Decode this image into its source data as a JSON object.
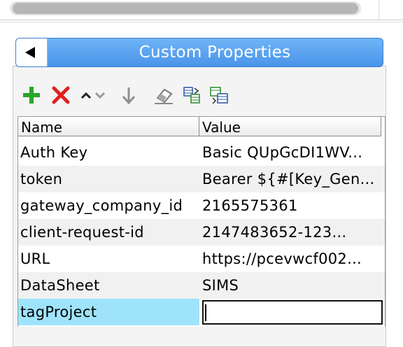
{
  "panel": {
    "title": "Custom Properties"
  },
  "toolbar": {
    "buttons": [
      {
        "name": "add-property-button",
        "icon": "plus-icon",
        "color": "#2aa52a"
      },
      {
        "name": "delete-property-button",
        "icon": "x-icon",
        "color": "#e02020"
      },
      {
        "name": "move-up-button",
        "icon": "caret-up-icon"
      },
      {
        "name": "move-down-button",
        "icon": "caret-down-icon"
      },
      {
        "name": "arrow-down-button",
        "icon": "arrow-down-icon"
      },
      {
        "name": "clear-button",
        "icon": "eraser-icon"
      },
      {
        "name": "import-button",
        "icon": "import-table-icon"
      },
      {
        "name": "export-button",
        "icon": "export-table-icon"
      }
    ]
  },
  "table": {
    "columns": [
      "Name",
      "Value"
    ],
    "rows": [
      {
        "name": "Auth Key",
        "value": "Basic QUpGcDI1WV..."
      },
      {
        "name": "token",
        "value": "Bearer ${#[Key_Gen..."
      },
      {
        "name": "gateway_company_id",
        "value": "2165575361"
      },
      {
        "name": "client-request-id",
        "value": "2147483652-123..."
      },
      {
        "name": "URL",
        "value": "https://pcevwcf002..."
      },
      {
        "name": "DataSheet",
        "value": "SIMS"
      },
      {
        "name": "tagProject",
        "value": ""
      }
    ]
  },
  "colors": {
    "header_gradient_top": "#6fb4f6",
    "header_gradient_bottom": "#4a94ea",
    "selected_row": "#9fe3fb"
  }
}
